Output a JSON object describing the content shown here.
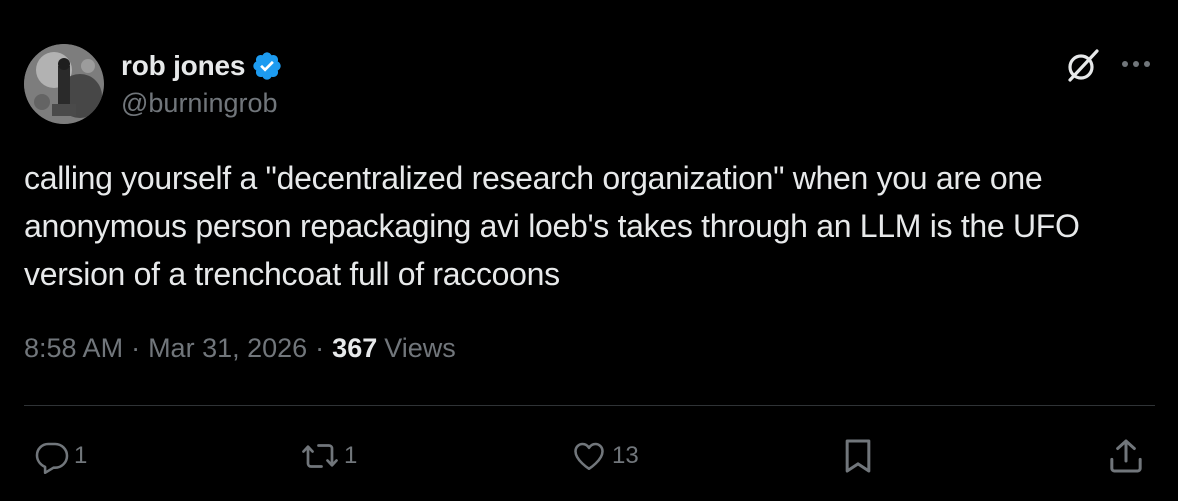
{
  "author": {
    "display_name": "rob jones",
    "handle": "@burningrob",
    "verified": true,
    "verified_color": "#1d9bf0"
  },
  "header_icons": {
    "grok": "grok-icon",
    "more": "more-options-icon"
  },
  "tweet": {
    "text": "calling yourself a \"decentralized research organization\" when you are one anonymous person repackaging avi loeb's takes through an LLM is the UFO version of a trenchcoat full of raccoons"
  },
  "meta": {
    "time": "8:58 AM",
    "separator": "·",
    "date": "Mar 31, 2026",
    "views_count": "367",
    "views_label": "Views"
  },
  "actions": {
    "reply": {
      "icon": "reply-icon",
      "count": "1"
    },
    "retweet": {
      "icon": "retweet-icon",
      "count": "1"
    },
    "like": {
      "icon": "heart-icon",
      "count": "13"
    },
    "bookmark": {
      "icon": "bookmark-icon"
    },
    "share": {
      "icon": "share-icon"
    }
  },
  "colors": {
    "background": "#000000",
    "text_primary": "#e7e9ea",
    "text_secondary": "#71767b",
    "divider": "#2f3336",
    "accent": "#1d9bf0"
  }
}
